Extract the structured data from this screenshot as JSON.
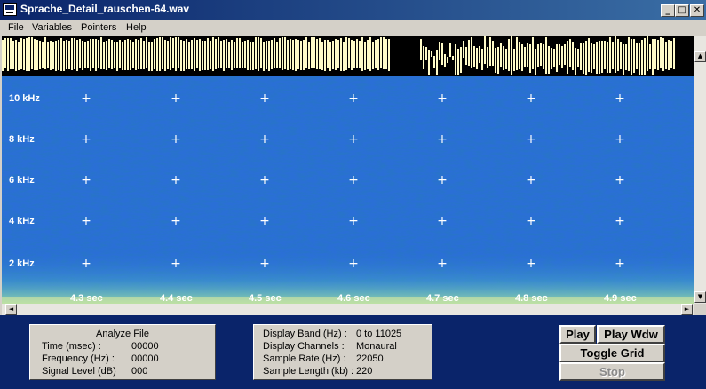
{
  "window": {
    "title": "Sprache_Detail_rauschen-64.wav",
    "controls": {
      "minimize": "_",
      "maximize": "□",
      "close": "✕"
    }
  },
  "menu": [
    "File",
    "Variables",
    "Pointers",
    "Help"
  ],
  "spectrogram": {
    "freq_labels": [
      "10 kHz",
      "8  kHz",
      "6  kHz",
      "4  kHz",
      "2  kHz"
    ],
    "time_labels": [
      "4.3 sec",
      "4.4 sec",
      "4.5 sec",
      "4.6 sec",
      "4.7 sec",
      "4.8 sec",
      "4.9 sec"
    ],
    "grid_marker": "+",
    "colors": {
      "background": "#2a6fd6",
      "waveform": "#fffbc8",
      "low_band": "#9bdca8"
    }
  },
  "scroll": {
    "up": "▲",
    "down": "▼",
    "left": "◄",
    "right": "►"
  },
  "analyze_panel": {
    "title": "Analyze File",
    "rows": [
      {
        "label": "Time (msec) :",
        "value": "00000"
      },
      {
        "label": "Frequency (Hz) :",
        "value": "00000"
      },
      {
        "label": "Signal Level (dB)",
        "value": "000"
      }
    ]
  },
  "info_panel": {
    "rows": [
      {
        "label": "Display Band (Hz) :",
        "value": "0 to 11025"
      },
      {
        "label": "Display Channels :",
        "value": "Monaural"
      },
      {
        "label": "Sample Rate (Hz) :",
        "value": "22050"
      },
      {
        "label": "Sample Length (kb) :",
        "value": "220"
      }
    ]
  },
  "buttons": {
    "play": "Play",
    "play_wdw": "Play Wdw",
    "toggle_grid": "Toggle Grid",
    "stop": "Stop"
  }
}
